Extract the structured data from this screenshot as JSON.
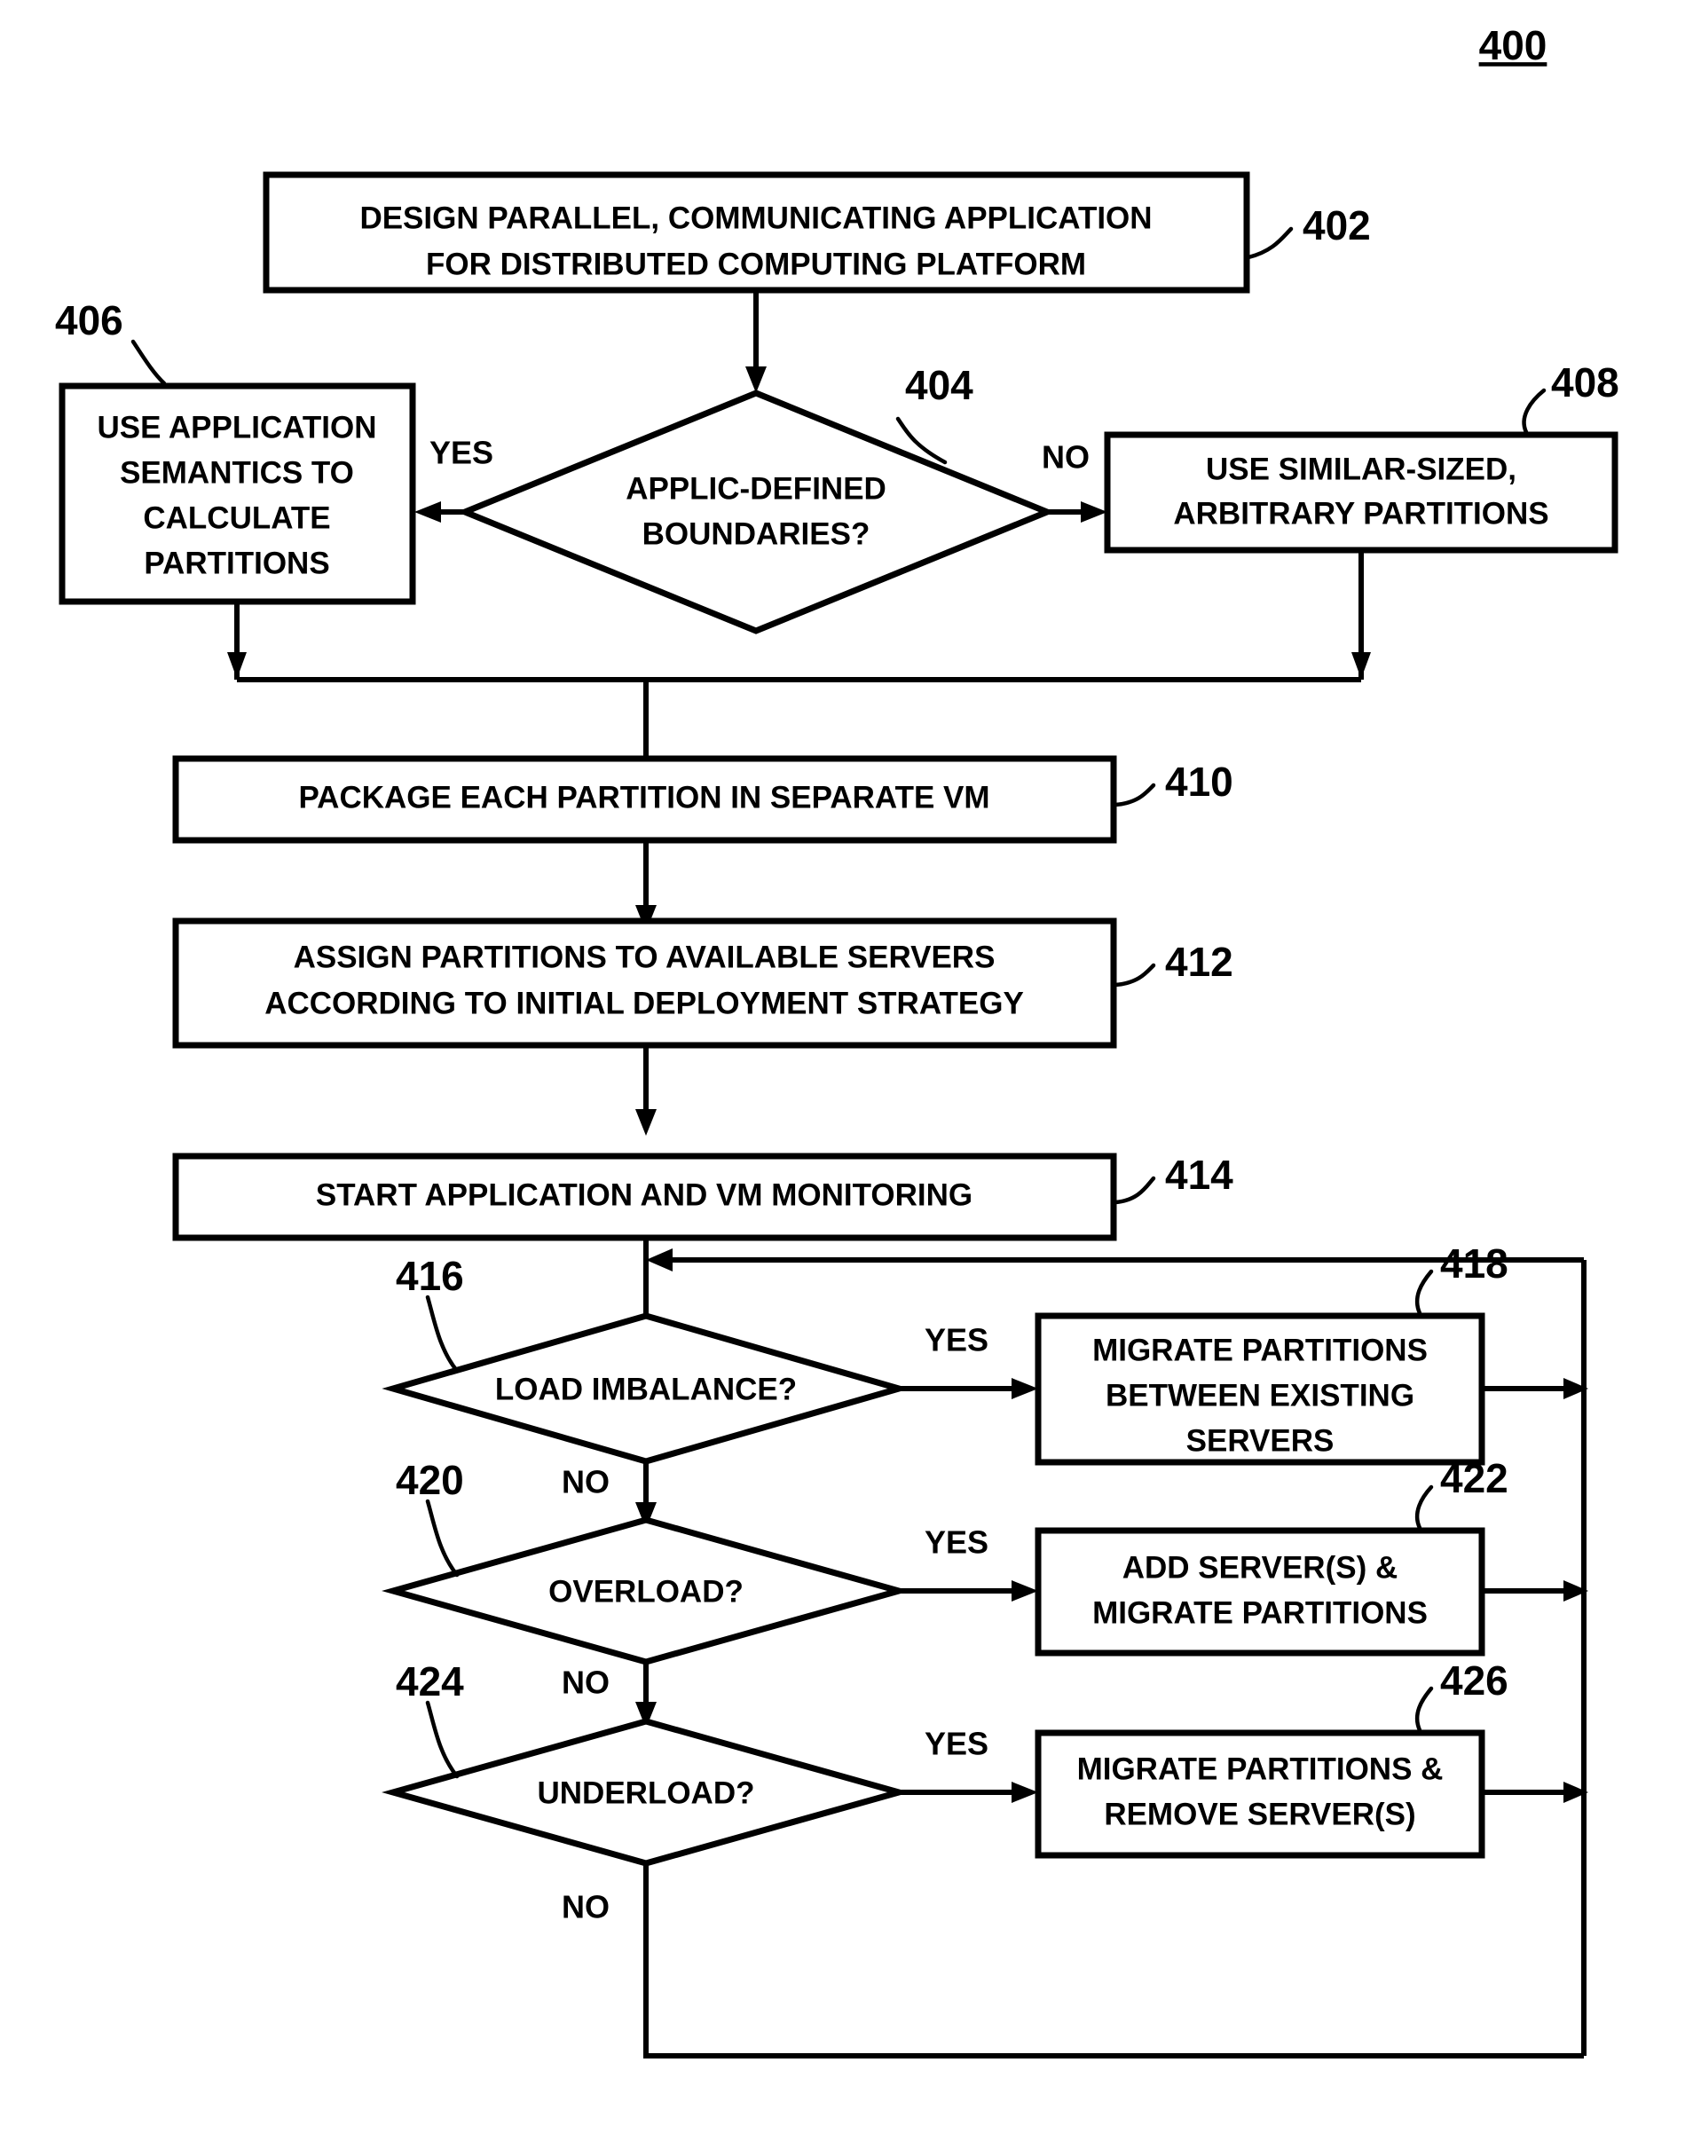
{
  "figure": {
    "number": "400",
    "type": "patent-flowchart"
  },
  "nodes": {
    "n402": {
      "ref": "402",
      "shape": "process",
      "lines": [
        "DESIGN PARALLEL, COMMUNICATING APPLICATION",
        "FOR DISTRIBUTED COMPUTING PLATFORM"
      ]
    },
    "n404": {
      "ref": "404",
      "shape": "decision",
      "lines": [
        "APPLIC-DEFINED",
        "BOUNDARIES?"
      ]
    },
    "n406": {
      "ref": "406",
      "shape": "process",
      "lines": [
        "USE APPLICATION",
        "SEMANTICS TO",
        "CALCULATE",
        "PARTITIONS"
      ]
    },
    "n408": {
      "ref": "408",
      "shape": "process",
      "lines": [
        "USE SIMILAR-SIZED,",
        "ARBITRARY PARTITIONS"
      ]
    },
    "n410": {
      "ref": "410",
      "shape": "process",
      "lines": [
        "PACKAGE EACH PARTITION IN SEPARATE VM"
      ]
    },
    "n412": {
      "ref": "412",
      "shape": "process",
      "lines": [
        "ASSIGN PARTITIONS TO AVAILABLE SERVERS",
        "ACCORDING TO INITIAL DEPLOYMENT STRATEGY"
      ]
    },
    "n414": {
      "ref": "414",
      "shape": "process",
      "lines": [
        "START APPLICATION AND VM MONITORING"
      ]
    },
    "n416": {
      "ref": "416",
      "shape": "decision",
      "lines": [
        "LOAD IMBALANCE?"
      ]
    },
    "n418": {
      "ref": "418",
      "shape": "process",
      "lines": [
        "MIGRATE PARTITIONS",
        "BETWEEN EXISTING",
        "SERVERS"
      ]
    },
    "n420": {
      "ref": "420",
      "shape": "decision",
      "lines": [
        "OVERLOAD?"
      ]
    },
    "n422": {
      "ref": "422",
      "shape": "process",
      "lines": [
        "ADD SERVER(S) &",
        "MIGRATE PARTITIONS"
      ]
    },
    "n424": {
      "ref": "424",
      "shape": "decision",
      "lines": [
        "UNDERLOAD?"
      ]
    },
    "n426": {
      "ref": "426",
      "shape": "process",
      "lines": [
        "MIGRATE PARTITIONS &",
        "REMOVE SERVER(S)"
      ]
    }
  },
  "branch_labels": {
    "yes_404": "YES",
    "no_404": "NO",
    "yes_416": "YES",
    "no_416": "NO",
    "yes_420": "YES",
    "no_420": "NO",
    "yes_424": "YES",
    "no_424": "NO"
  },
  "colors": {
    "line": "#000000",
    "fill": "#ffffff",
    "text": "#000000"
  }
}
